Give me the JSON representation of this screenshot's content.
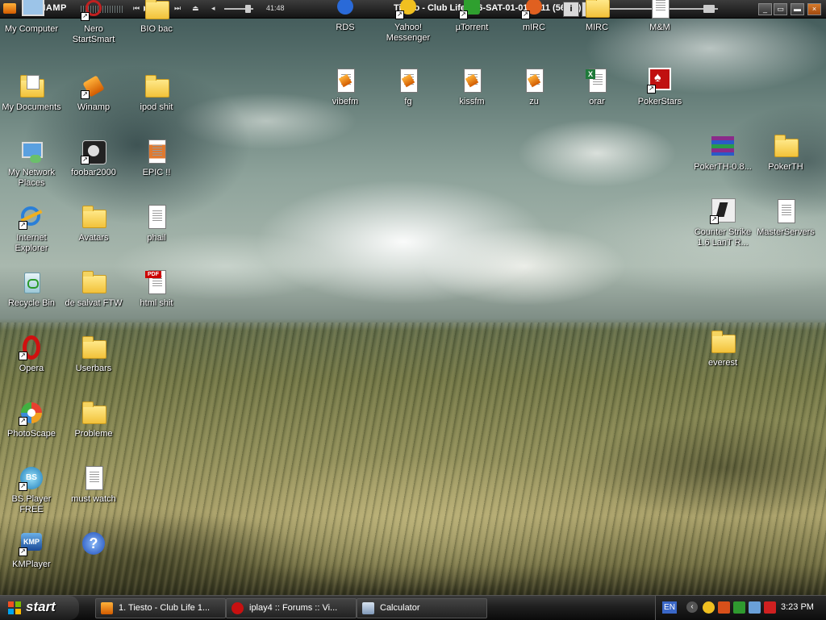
{
  "winamp": {
    "app_label": "WINAMP",
    "time": "41:48",
    "track_title": "Tiesto - Club Life 196-SAT-01-01-2011 (56:22)",
    "info_button": "i",
    "search_button": "⌕"
  },
  "desktop": {
    "icons_col1": [
      {
        "label": "My Computer",
        "icon": "my-computer-icon"
      },
      {
        "label": "My Documents",
        "icon": "my-documents-icon"
      },
      {
        "label": "My Network Places",
        "icon": "network-places-icon"
      },
      {
        "label": "Internet Explorer",
        "icon": "internet-explorer-icon"
      },
      {
        "label": "Recycle Bin",
        "icon": "recycle-bin-icon"
      },
      {
        "label": "Opera",
        "icon": "opera-icon"
      },
      {
        "label": "PhotoScape",
        "icon": "photoscape-icon"
      },
      {
        "label": "BS.Player FREE",
        "icon": "bsplayer-icon"
      },
      {
        "label": "KMPlayer",
        "icon": "kmplayer-icon"
      }
    ],
    "icons_col2": [
      {
        "label": "Nero StartSmart",
        "icon": "nero-icon"
      },
      {
        "label": "Winamp",
        "icon": "winamp-icon"
      },
      {
        "label": "foobar2000",
        "icon": "foobar-icon"
      },
      {
        "label": "Avatars",
        "icon": "folder-icon"
      },
      {
        "label": "de salvat FTW",
        "icon": "folder-icon"
      },
      {
        "label": "Userbars",
        "icon": "folder-icon"
      },
      {
        "label": "Probleme",
        "icon": "folder-icon"
      },
      {
        "label": "must watch",
        "icon": "text-file-icon"
      },
      {
        "label": "",
        "icon": "help-icon"
      }
    ],
    "icons_col3": [
      {
        "label": "BIO bac",
        "icon": "folder-icon"
      },
      {
        "label": "ipod shit",
        "icon": "folder-icon"
      },
      {
        "label": "EPIC !!",
        "icon": "image-file-icon"
      },
      {
        "label": "phail",
        "icon": "text-file-icon"
      },
      {
        "label": "html shit",
        "icon": "pdf-file-icon"
      }
    ],
    "icons_top": [
      {
        "label": "RDS",
        "icon": "rds-icon"
      },
      {
        "label": "Yahoo! Messenger",
        "icon": "yahoo-messenger-icon"
      },
      {
        "label": "µTorrent",
        "icon": "utorrent-icon"
      },
      {
        "label": "mIRC",
        "icon": "mirc-icon"
      },
      {
        "label": "MIRC",
        "icon": "mirc-folder-icon"
      },
      {
        "label": "M&M",
        "icon": "document-icon"
      }
    ],
    "icons_row2": [
      {
        "label": "vibefm",
        "icon": "winamp-playlist-icon"
      },
      {
        "label": "fg",
        "icon": "winamp-playlist-icon"
      },
      {
        "label": "kissfm",
        "icon": "winamp-playlist-icon"
      },
      {
        "label": "zu",
        "icon": "winamp-playlist-icon"
      },
      {
        "label": "orar",
        "icon": "excel-file-icon"
      },
      {
        "label": "PokerStars",
        "icon": "pokerstars-icon"
      }
    ],
    "icons_right": [
      {
        "label": "PokerTH-0.8...",
        "icon": "winrar-icon"
      },
      {
        "label": "PokerTH",
        "icon": "folder-icon"
      },
      {
        "label": "Counter Strike 1.6 LanT R...",
        "icon": "counter-strike-icon"
      },
      {
        "label": "MasterServers",
        "icon": "document-icon"
      },
      {
        "label": "everest",
        "icon": "folder-icon"
      }
    ]
  },
  "taskbar": {
    "start_label": "start",
    "tasks": [
      {
        "label": "1. Tiesto - Club Life 1...",
        "icon": "winamp-task-icon"
      },
      {
        "label": "iplay4 :: Forums :: Vi...",
        "icon": "opera-task-icon"
      },
      {
        "label": "Calculator",
        "icon": "calculator-icon"
      }
    ],
    "tray": {
      "language": "EN",
      "clock": "3:23 PM"
    }
  }
}
